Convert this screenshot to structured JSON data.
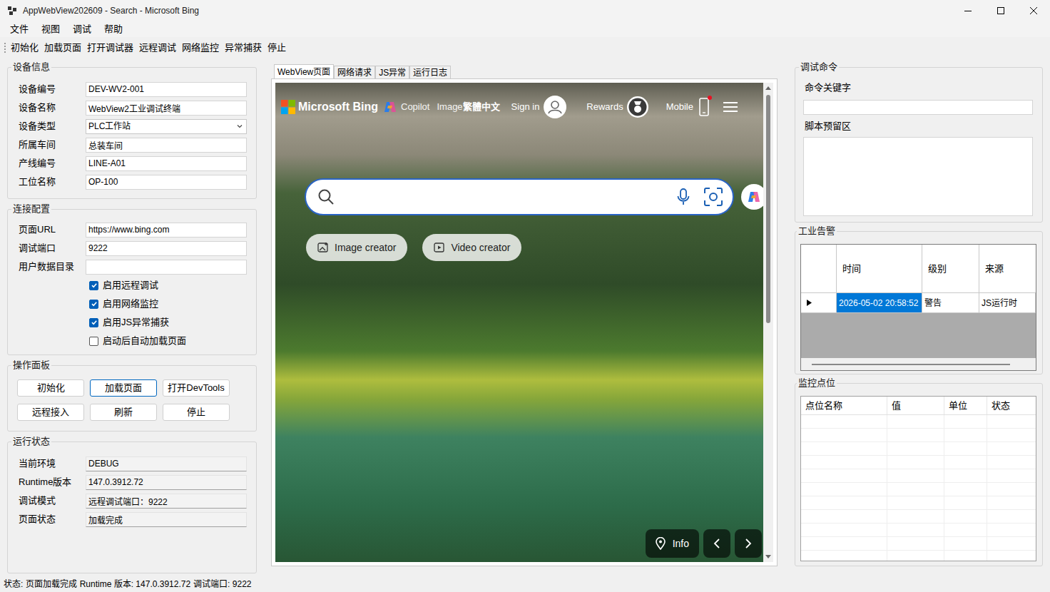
{
  "window": {
    "title": "AppWebView202609 - Search - Microsoft Bing"
  },
  "menu": [
    {
      "label": "文件"
    },
    {
      "label": "视图"
    },
    {
      "label": "调试"
    },
    {
      "label": "帮助"
    }
  ],
  "toolbar": [
    {
      "label": "初始化"
    },
    {
      "label": "加载页面"
    },
    {
      "label": "打开调试器"
    },
    {
      "label": "远程调试"
    },
    {
      "label": "网络监控"
    },
    {
      "label": "异常捕获"
    },
    {
      "label": "停止"
    }
  ],
  "device_info": {
    "title": "设备信息",
    "fields": [
      {
        "label": "设备编号",
        "value": "DEV-WV2-001",
        "kind": "text"
      },
      {
        "label": "设备名称",
        "value": "WebView2工业调试终端",
        "kind": "text"
      },
      {
        "label": "设备类型",
        "value": "PLC工作站",
        "kind": "select"
      },
      {
        "label": "所属车间",
        "value": "总装车间",
        "kind": "text"
      },
      {
        "label": "产线编号",
        "value": "LINE-A01",
        "kind": "text"
      },
      {
        "label": "工位名称",
        "value": "OP-100",
        "kind": "text"
      }
    ]
  },
  "connection": {
    "title": "连接配置",
    "fields": [
      {
        "label": "页面URL",
        "value": "https://www.bing.com"
      },
      {
        "label": "调试端口",
        "value": "9222"
      },
      {
        "label": "用户数据目录",
        "value": ""
      }
    ],
    "options": [
      {
        "label": "启用远程调试",
        "checked": true
      },
      {
        "label": "启用网络监控",
        "checked": true
      },
      {
        "label": "启用JS异常捕获",
        "checked": true
      },
      {
        "label": "启动后自动加载页面",
        "checked": false
      }
    ]
  },
  "operations": {
    "title": "操作面板",
    "buttons": [
      {
        "label": "初始化",
        "focused": false
      },
      {
        "label": "加载页面",
        "focused": true
      },
      {
        "label": "打开DevTools",
        "focused": false
      },
      {
        "label": "远程接入",
        "focused": false
      },
      {
        "label": "刷新",
        "focused": false
      },
      {
        "label": "停止",
        "focused": false
      }
    ]
  },
  "runtime": {
    "title": "运行状态",
    "fields": [
      {
        "label": "当前环境",
        "value": "DEBUG"
      },
      {
        "label": "Runtime版本",
        "value": "147.0.3912.72"
      },
      {
        "label": "调试模式",
        "value": "远程调试端口：9222"
      },
      {
        "label": "页面状态",
        "value": "加载完成"
      }
    ]
  },
  "tabs": [
    {
      "label": "WebView页面",
      "selected": true
    },
    {
      "label": "网络请求",
      "selected": false
    },
    {
      "label": "JS异常",
      "selected": false
    },
    {
      "label": "运行日志",
      "selected": false
    }
  ],
  "browser": {
    "logo": "Microsoft Bing",
    "nav": [
      {
        "label": "Copilot"
      },
      {
        "label": "Image"
      },
      {
        "label": "繁體中文"
      }
    ],
    "sign_in": "Sign in",
    "rewards": "Rewards",
    "mobile": {
      "label": "Mobile",
      "notification": true
    },
    "search": {
      "placeholder": ""
    },
    "creators": [
      {
        "label": "Image creator"
      },
      {
        "label": "Video creator"
      }
    ],
    "info": "Info"
  },
  "debug": {
    "title": "调试命令",
    "keyword_label": "命令关键字",
    "keyword_value": "",
    "script_label": "脚本预留区",
    "script_value": ""
  },
  "alarms": {
    "title": "工业告警",
    "columns": [
      "时间",
      "级别",
      "来源"
    ],
    "rows": [
      {
        "current": true,
        "cells": [
          {
            "text": "2026-05-02 20:58:52",
            "selected": true
          },
          {
            "text": "警告",
            "selected": false
          },
          {
            "text": "JS运行时",
            "selected": false
          }
        ]
      }
    ]
  },
  "points": {
    "title": "监控点位",
    "columns": [
      "点位名称",
      "值",
      "单位",
      "状态"
    ],
    "rows": []
  },
  "status_bar": {
    "items": [
      "状态: 页面加载完成",
      "Runtime 版本: 147.0.3912.72",
      "调试端口: 9222"
    ]
  }
}
